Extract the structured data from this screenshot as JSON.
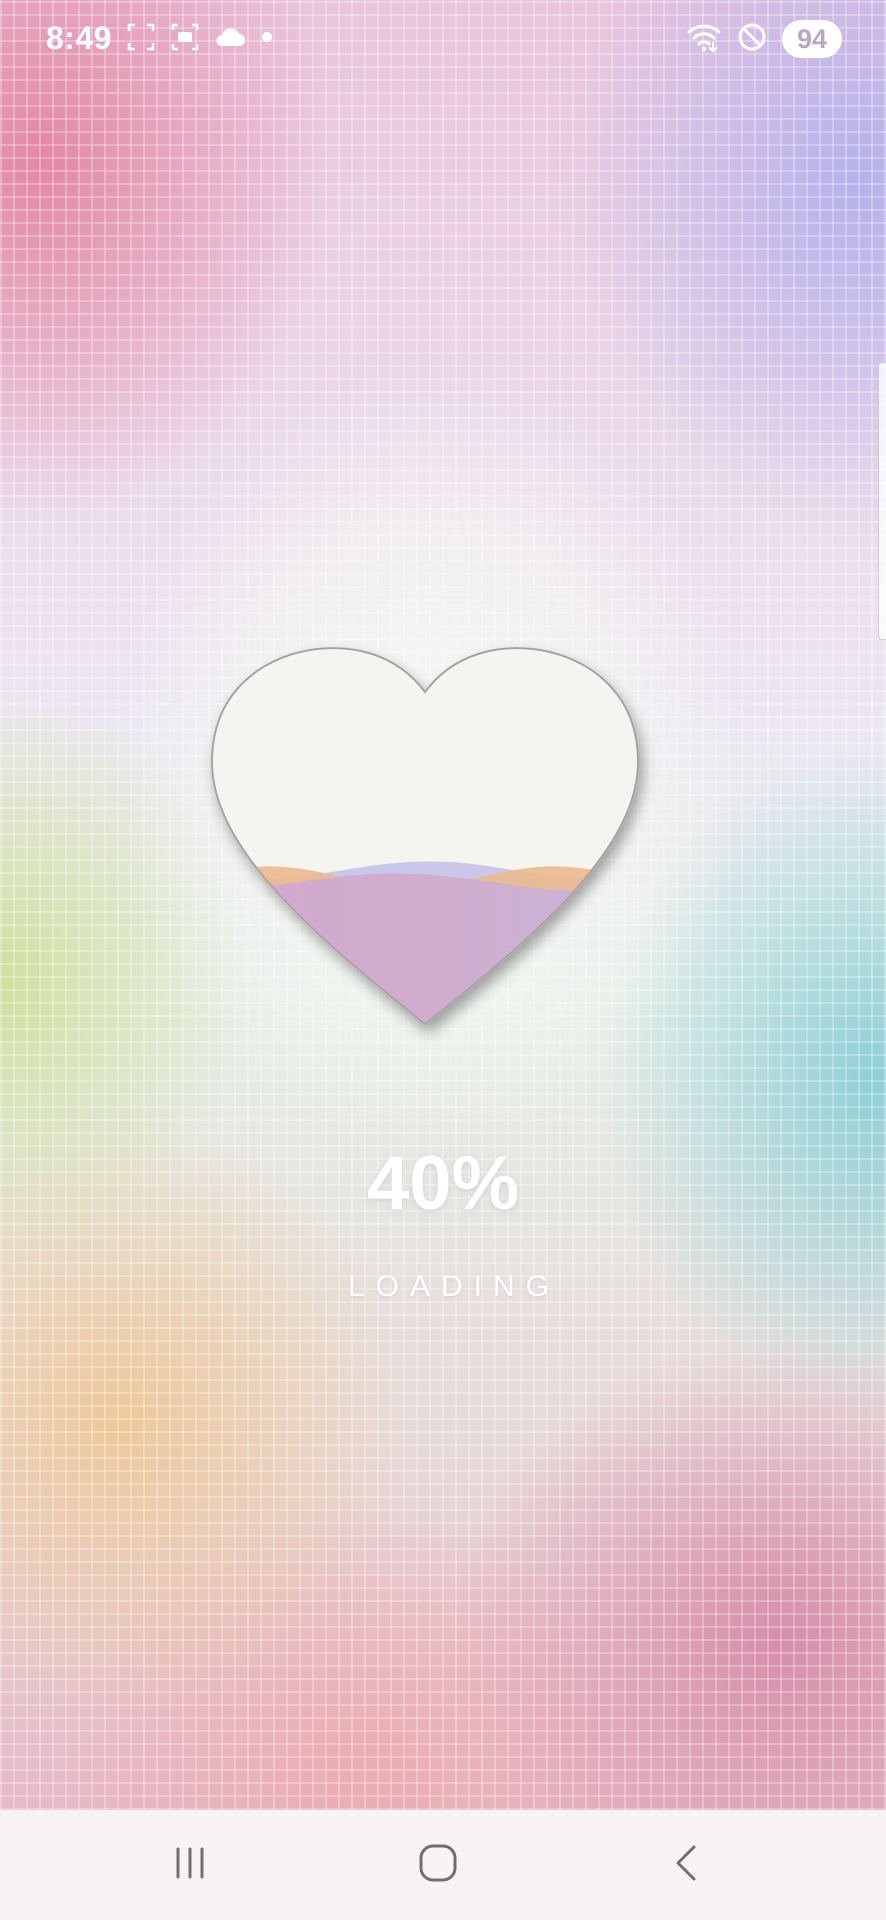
{
  "status_bar": {
    "time": "8:49",
    "left_icons": [
      "screenshot-frame-icon",
      "screen-capture-icon",
      "cloud-icon",
      "notification-dot-icon"
    ],
    "right_icons": [
      "wifi-icon",
      "do-not-disturb-icon"
    ],
    "battery_level": "94"
  },
  "loader": {
    "progress_percent": 40,
    "percent_text": "40%",
    "status_text": "LOADING",
    "fill_colors": {
      "liquid": "#cfa9cc",
      "wave_back": "#c9c0e6",
      "wave_accent": "#e8b88f",
      "heart_glass": "#f5f5f2"
    }
  },
  "navigation_bar": {
    "buttons": [
      "recent-apps",
      "home",
      "back"
    ]
  }
}
